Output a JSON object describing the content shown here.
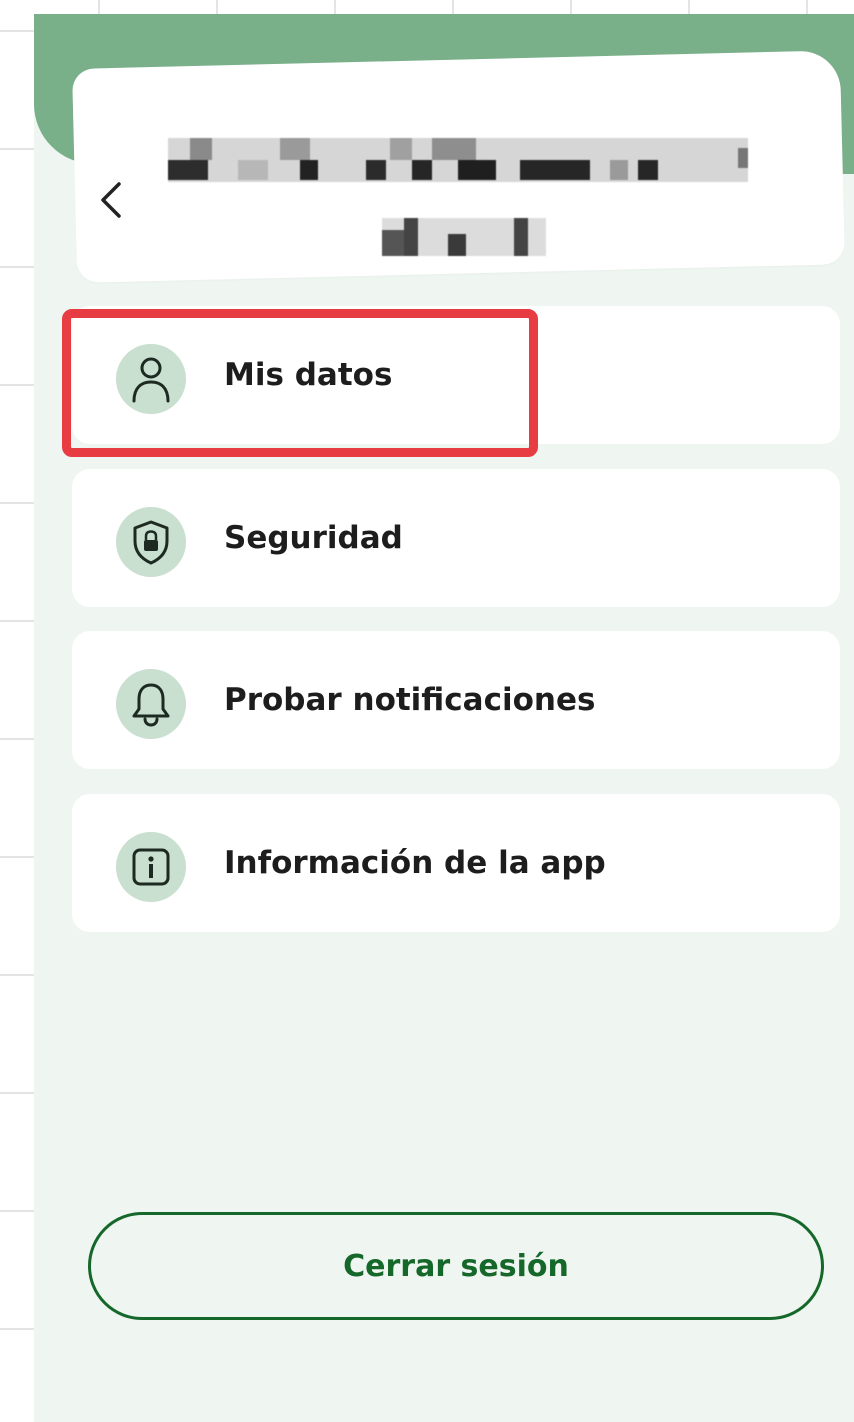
{
  "header": {
    "back_icon": "chevron-left-icon",
    "back_glyph": "‹"
  },
  "menu": {
    "items": [
      {
        "label": "Mis datos",
        "icon": "user-icon"
      },
      {
        "label": "Seguridad",
        "icon": "shield-lock-icon"
      },
      {
        "label": "Probar notificaciones",
        "icon": "bell-icon"
      },
      {
        "label": "Información de la app",
        "icon": "info-icon"
      }
    ]
  },
  "logout": {
    "label": "Cerrar sesión"
  },
  "colors": {
    "header_green": "#79b08a",
    "screen_background": "#eff6f1",
    "icon_circle": "#c9dfd0",
    "highlight_red": "#e73d42",
    "button_green": "#15682a"
  }
}
